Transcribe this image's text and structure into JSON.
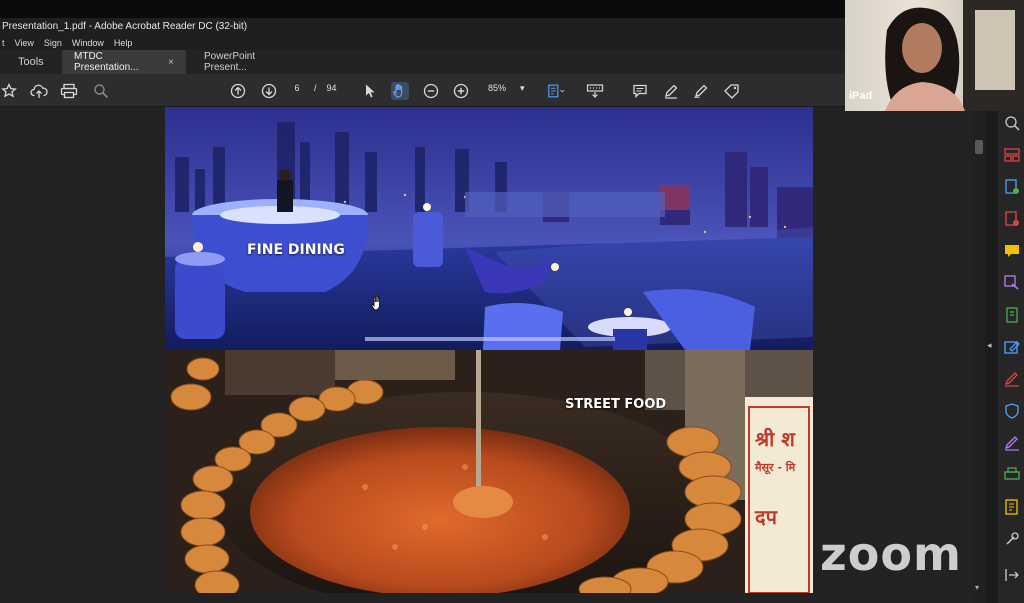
{
  "window": {
    "title": "Presentation_1.pdf - Adobe Acrobat Reader DC (32-bit)"
  },
  "menu": [
    "t",
    "View",
    "Sign",
    "Window",
    "Help"
  ],
  "tabs": [
    {
      "label": "Tools"
    },
    {
      "label": "MTDC Presentation...",
      "close": "×"
    },
    {
      "label": "PowerPoint Present..."
    }
  ],
  "toolbar": {
    "page_current": "6",
    "page_sep": "/",
    "page_total": "94",
    "zoom": "85%"
  },
  "slide": {
    "top_caption": "FINE DINING",
    "bottom_caption": "STREET FOOD",
    "sign_text_1": "श्री श",
    "sign_text_2": "मैसूर - मि",
    "sign_text_3": "दप"
  },
  "webcam": {
    "label": "iPad"
  },
  "overlay": {
    "watermark": "zoom"
  },
  "colors": {
    "acrobat_red_icon": "#e0443e",
    "panel_icon_green": "#4caf50",
    "panel_icon_blue": "#4aa3ff",
    "panel_icon_purple": "#b57cff",
    "panel_icon_yellow": "#f2c200"
  }
}
